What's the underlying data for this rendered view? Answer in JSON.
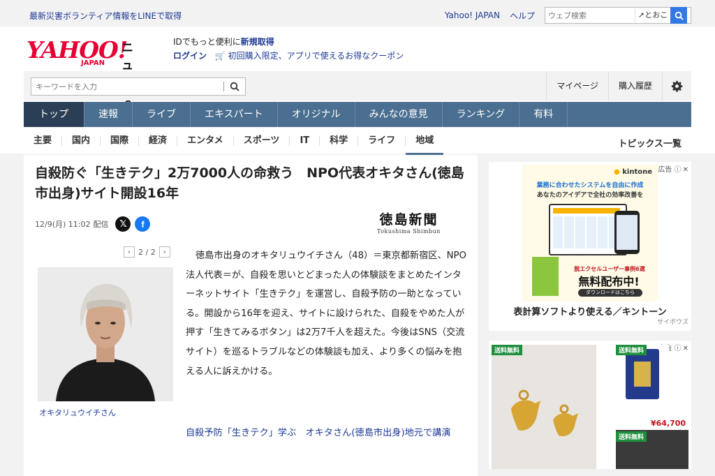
{
  "topbar": {
    "line_link": "最新災害ボランティア情報をLINEで取得",
    "yahoo_japan": "Yahoo! JAPAN",
    "help": "ヘルプ",
    "search_placeholder": "ウェブ検索",
    "location": "とおこ"
  },
  "header": {
    "logo_main": "YAHOO!",
    "logo_sub": "JAPAN",
    "logo_news": "ニュース",
    "promo_line1_prefix": "IDでもっと便利に",
    "promo_line1_link": "新規取得",
    "promo_login": "ログイン",
    "promo_coupon": "初回購入限定、アプリで使えるお得なクーポン"
  },
  "searchrow": {
    "keyword_placeholder": "キーワードを入力",
    "mypage": "マイページ",
    "history": "購入履歴"
  },
  "global_nav": [
    "トップ",
    "速報",
    "ライブ",
    "エキスパート",
    "オリジナル",
    "みんなの意見",
    "ランキング",
    "有料"
  ],
  "sub_nav": [
    "主要",
    "国内",
    "国際",
    "経済",
    "エンタメ",
    "スポーツ",
    "IT",
    "科学",
    "ライフ",
    "地域"
  ],
  "sub_nav_all": "トピックス一覧",
  "article": {
    "title": "自殺防ぐ「生きテク」2万7000人の命救う　NPO代表オキタさん(徳島市出身)サイト開設16年",
    "datetime": "12/9(月) 11:02",
    "delivered": "配信",
    "outlet_name": "徳島新聞",
    "outlet_en": "Tokushima Shimbun",
    "page_indicator": "2 / 2",
    "photo_caption": "オキタリュウイチさん",
    "body": "徳島市出身のオキタリュウイチさん（48）＝東京都新宿区、NPO法人代表＝が、自殺を思いとどまった人の体験談をまとめたインターネットサイト「生きテク」を運営し、自殺予防の一助となっている。開設から16年を迎え、サイトに設けられた、自殺をやめた人が押す「生きてみるボタン」は2万7千人を超えた。今後はSNS（交流サイト）を巡るトラブルなどの体験談も加え、より多くの悩みを抱える人に訴えかける。",
    "related_link": "自殺予防「生きテク」学ぶ　オキタさん(徳島市出身)地元で講演"
  },
  "ads": {
    "ad_label": "広告",
    "ad1_brand": "kintone",
    "ad1_headline1": "業務に合わせたシステムを自由に作成",
    "ad1_headline2": "あなたのアイデアで全社の効率改善を",
    "ad1_banner": "無料配布中!",
    "ad1_banner_top": "脱エクセルユーザー事例6選",
    "ad1_download": "ダウンロードはこちら",
    "ad1_caption": "表計算ソフトより使える／キントーン",
    "ad1_sponsor": "サイボウズ",
    "ad2_badge": "送料無料",
    "ad2_price": "¥64,700"
  },
  "colors": {
    "brand_red": "#e60033",
    "nav_blue": "#4a6f90",
    "link_blue": "#1d3994"
  }
}
